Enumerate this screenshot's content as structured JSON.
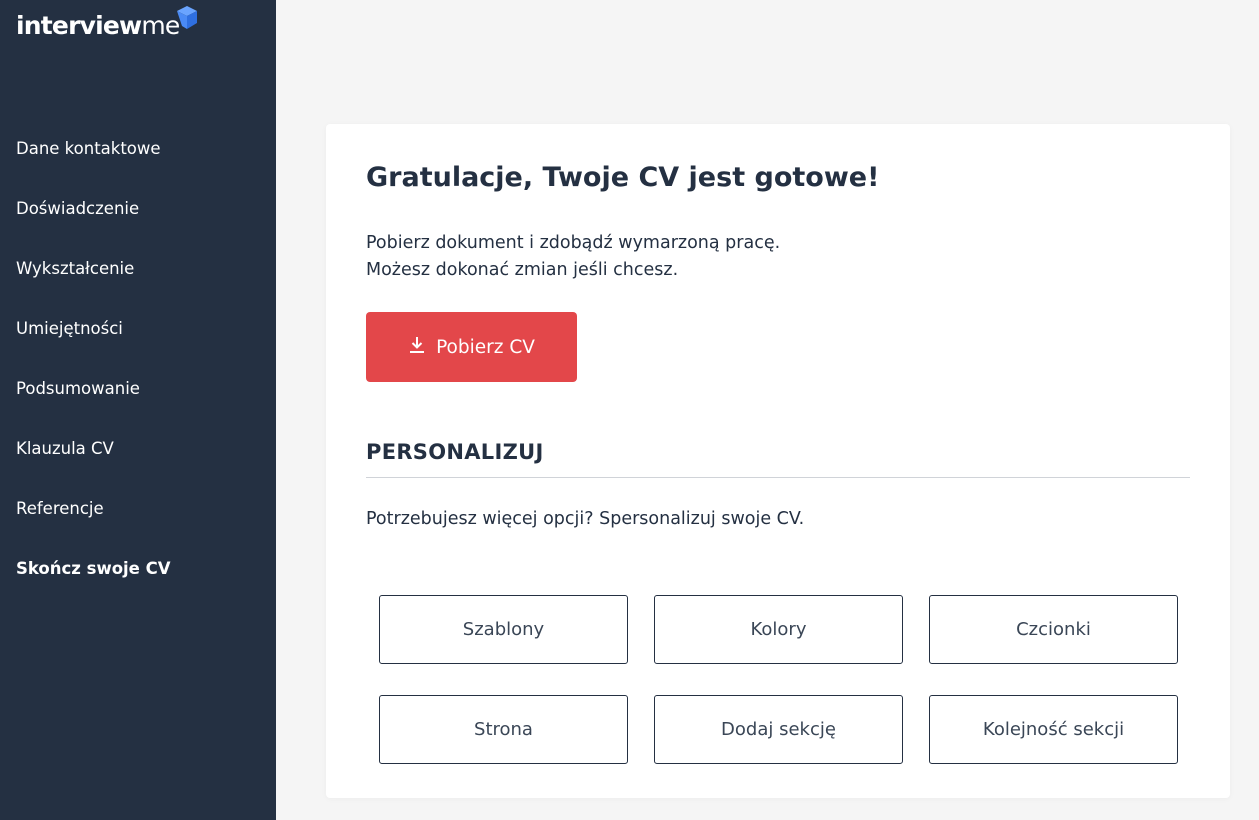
{
  "brand": {
    "logo_part1": "interview",
    "logo_part2": "me",
    "icon": "cube-logo-icon"
  },
  "sidebar": {
    "items": [
      {
        "label": "Dane kontaktowe",
        "active": false
      },
      {
        "label": "Doświadczenie",
        "active": false
      },
      {
        "label": "Wykształcenie",
        "active": false
      },
      {
        "label": "Umiejętności",
        "active": false
      },
      {
        "label": "Podsumowanie",
        "active": false
      },
      {
        "label": "Klauzula CV",
        "active": false
      },
      {
        "label": "Referencje",
        "active": false
      },
      {
        "label": "Skończ swoje CV",
        "active": true
      }
    ]
  },
  "main": {
    "title": "Gratulacje, Twoje CV jest gotowe!",
    "lead_line1": "Pobierz dokument i zdobądź wymarzoną pracę.",
    "lead_line2": "Możesz dokonać zmian jeśli chcesz.",
    "download_label": "Pobierz CV",
    "download_icon": "download-icon",
    "section_title": "PERSONALIZUJ",
    "section_subtitle": "Potrzebujesz więcej opcji? Spersonalizuj swoje CV.",
    "options": [
      {
        "label": "Szablony"
      },
      {
        "label": "Kolory"
      },
      {
        "label": "Czcionki"
      },
      {
        "label": "Strona"
      },
      {
        "label": "Dodaj sekcję"
      },
      {
        "label": "Kolejność sekcji"
      }
    ]
  },
  "colors": {
    "sidebar_bg": "#243042",
    "accent_red": "#e3474a",
    "logo_blue": "#3a7cf0",
    "page_bg": "#f5f5f5"
  }
}
